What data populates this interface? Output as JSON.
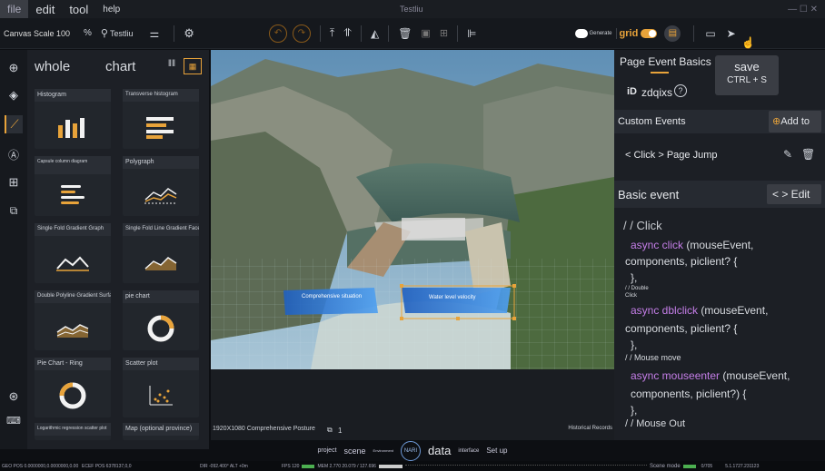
{
  "menu": {
    "file": "file",
    "edit": "edit",
    "tool": "tool",
    "help": "help",
    "window_title": "Testliu",
    "window_controls": "— ☐ ✕"
  },
  "toolbar": {
    "canvas_scale_label": "Canvas Scale 100",
    "canvas_scale_unit": "%",
    "project_name": "Testliu",
    "generate_label": "Generate",
    "grid_label": "grid"
  },
  "left_panel": {
    "tab_whole": "whole",
    "tab_chart": "chart",
    "cards": [
      "Histogram",
      "Transverse histogram",
      "Capsule column diagram",
      "Polygraph",
      "Single Fold Gradient Graph",
      "Single Fold Line Gradient Face...",
      "Double Polyline Gradient Surface...",
      "pie chart",
      "Pie Chart - Ring",
      "Scatter plot",
      "Logarithmic regression scatter plot",
      "Map (optional province)"
    ]
  },
  "viewport": {
    "label_left": "Comprehensive situation",
    "label_right": "Water level velocity"
  },
  "under_viewport": {
    "resolution": "1920X1080 Comprehensive Posture",
    "layer_count": "1",
    "history": "Historical Records"
  },
  "bottom_tabs": [
    "project",
    "scene",
    "Environment",
    "NARI",
    "data",
    "interface",
    "Set up"
  ],
  "right_panel": {
    "title": "Page Event Basics",
    "id_label": "iD",
    "id_value": "zdqixs",
    "custom_events": "Custom Events",
    "add_to": "Add to",
    "event_item": "< Click > Page Jump",
    "basic_event": "Basic event",
    "edit": "< > Edit",
    "code": {
      "c1": "/ / Click",
      "l1a": "async click",
      "l1b": " (mouseEvent,",
      "l1c": "components, piclient? {",
      "l1d": "},",
      "c2": "/ / Double",
      "c2b": "Click",
      "l2a": "async dblclick",
      "l2b": " (mouseEvent,",
      "l2c": "components, piclient? {",
      "l2d": "},",
      "c3": "/ / Mouse move",
      "l3a": "async mouseenter",
      "l3b": " (mouseEvent,",
      "l3c": "components, piclient?) {",
      "l3d": "},",
      "c4": "/ / Mouse Out"
    }
  },
  "tooltip": {
    "title": "save",
    "shortcut": "CTRL + S"
  },
  "status": {
    "s1": "GEO POS  0.0000000,0.0000000,0.00",
    "s2": "ECEF POS  6378137,0,0",
    "s3": "DIR  -092.400°  ALT  +0m",
    "s4": "FPS  120",
    "s5": "MEM  2.770  20.079 / 127.696",
    "s6": "Scene mode",
    "s7": "0/705",
    "s8": "5.1.1727.231123"
  },
  "colors": {
    "accent": "#e8a33a",
    "bg": "#0d0f13",
    "panel": "#1d2026",
    "keyword": "#c57ee8"
  }
}
